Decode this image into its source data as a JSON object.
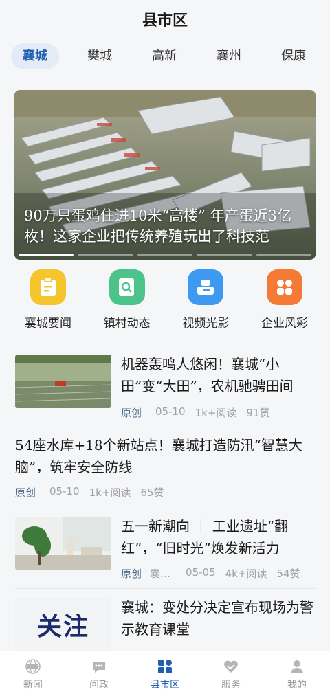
{
  "header": {
    "title": "县市区"
  },
  "tabs": [
    {
      "label": "襄城",
      "active": true
    },
    {
      "label": "樊城",
      "active": false
    },
    {
      "label": "高新",
      "active": false
    },
    {
      "label": "襄州",
      "active": false
    },
    {
      "label": "保康",
      "active": false
    }
  ],
  "banner": {
    "caption": "90万只蛋鸡住进10米“高楼” 年产蛋近3亿枚！这家企业把传统养殖玩出了科技范",
    "slide_count": 5,
    "active_slide": 1
  },
  "shortcuts": [
    {
      "label": "襄城要闻",
      "icon": "document-icon",
      "color": "#f5c52e"
    },
    {
      "label": "镇村动态",
      "icon": "search-doc-icon",
      "color": "#4cc38a"
    },
    {
      "label": "视频光影",
      "icon": "video-camera-icon",
      "color": "#3d9af0"
    },
    {
      "label": "企业风彩",
      "icon": "grid-icon",
      "color": "#f57a35"
    }
  ],
  "news": [
    {
      "title": "机器轰鸣人悠闲！襄城“小田”变“大田”，农机驰骋田间",
      "tag": "原创",
      "date": "05-10",
      "reads": "1k+阅读",
      "likes": "91赞",
      "thumb": "farm-field"
    },
    {
      "title": "54座水库+18个新站点！襄城打造防汛“智慧大脑”，筑牢安全防线",
      "tag": "原创",
      "date": "05-10",
      "reads": "1k+阅读",
      "likes": "65赞"
    },
    {
      "title": "五一新潮向 ｜ 工业遗址“翻红”，“旧时光”焕发新活力",
      "tag": "原创",
      "source": "襄…",
      "date": "05-05",
      "reads": "4k+阅读",
      "likes": "54赞",
      "thumb": "interior"
    },
    {
      "title": "襄城：变处分决定宣布现场为警示教育课堂",
      "thumb_text": "关注"
    }
  ],
  "tabbar": [
    {
      "label": "新闻",
      "icon": "globe-news-icon",
      "active": false
    },
    {
      "label": "问政",
      "icon": "chat-icon",
      "active": false
    },
    {
      "label": "县市区",
      "icon": "grid-squares-icon",
      "active": true
    },
    {
      "label": "服务",
      "icon": "heart-hands-icon",
      "active": false
    },
    {
      "label": "我的",
      "icon": "user-icon",
      "active": false
    }
  ],
  "colors": {
    "accent": "#1f5fae",
    "tab_active_bg": "#e3ebf6"
  }
}
